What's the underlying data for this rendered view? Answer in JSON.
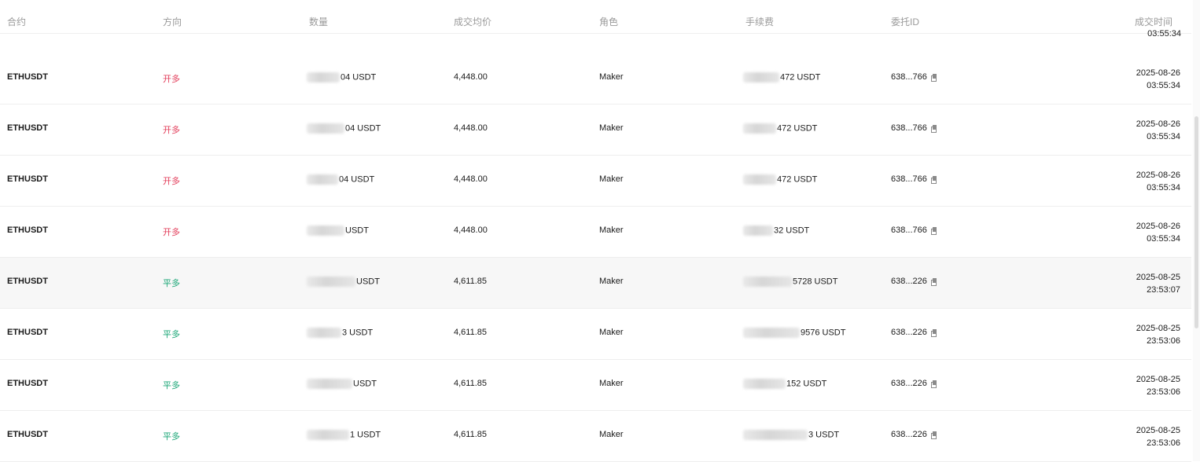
{
  "columns": {
    "contract": "合约",
    "direction": "方向",
    "quantity": "数量",
    "avg_price": "成交均价",
    "role": "角色",
    "fee": "手续费",
    "order_id": "委托ID",
    "time": "成交时间"
  },
  "partial_row_time": "03:55:34",
  "rows": [
    {
      "contract": "ETHUSDT",
      "direction": "开多",
      "dir_type": "long",
      "quantity_suffix": "04 USDT",
      "avg_price": "4,448.00",
      "role": "Maker",
      "fee_suffix": "472 USDT",
      "order_id": "638...766",
      "date": "2025-08-26",
      "time": "03:55:34"
    },
    {
      "contract": "ETHUSDT",
      "direction": "开多",
      "dir_type": "long",
      "quantity_suffix": "04 USDT",
      "avg_price": "4,448.00",
      "role": "Maker",
      "fee_suffix": "472 USDT",
      "order_id": "638...766",
      "date": "2025-08-26",
      "time": "03:55:34"
    },
    {
      "contract": "ETHUSDT",
      "direction": "开多",
      "dir_type": "long",
      "quantity_suffix": "04 USDT",
      "avg_price": "4,448.00",
      "role": "Maker",
      "fee_suffix": "472 USDT",
      "order_id": "638...766",
      "date": "2025-08-26",
      "time": "03:55:34"
    },
    {
      "contract": "ETHUSDT",
      "direction": "开多",
      "dir_type": "long",
      "quantity_suffix": "USDT",
      "avg_price": "4,448.00",
      "role": "Maker",
      "fee_suffix": "32 USDT",
      "order_id": "638...766",
      "date": "2025-08-26",
      "time": "03:55:34"
    },
    {
      "contract": "ETHUSDT",
      "direction": "平多",
      "dir_type": "close",
      "quantity_suffix": "USDT",
      "avg_price": "4,611.85",
      "role": "Maker",
      "fee_suffix": "5728 USDT",
      "order_id": "638...226",
      "date": "2025-08-25",
      "time": "23:53:07"
    },
    {
      "contract": "ETHUSDT",
      "direction": "平多",
      "dir_type": "close",
      "quantity_suffix": "3 USDT",
      "avg_price": "4,611.85",
      "role": "Maker",
      "fee_suffix": "9576 USDT",
      "order_id": "638...226",
      "date": "2025-08-25",
      "time": "23:53:06"
    },
    {
      "contract": "ETHUSDT",
      "direction": "平多",
      "dir_type": "close",
      "quantity_suffix": "USDT",
      "avg_price": "4,611.85",
      "role": "Maker",
      "fee_suffix": "152 USDT",
      "order_id": "638...226",
      "date": "2025-08-25",
      "time": "23:53:06"
    },
    {
      "contract": "ETHUSDT",
      "direction": "平多",
      "dir_type": "close",
      "quantity_suffix": "1 USDT",
      "avg_price": "4,611.85",
      "role": "Maker",
      "fee_suffix": "3 USDT",
      "order_id": "638...226",
      "date": "2025-08-25",
      "time": "23:53:06"
    }
  ],
  "colors": {
    "long": "#e23d5a",
    "close": "#1aa676",
    "header_text": "#9a9a9a"
  }
}
